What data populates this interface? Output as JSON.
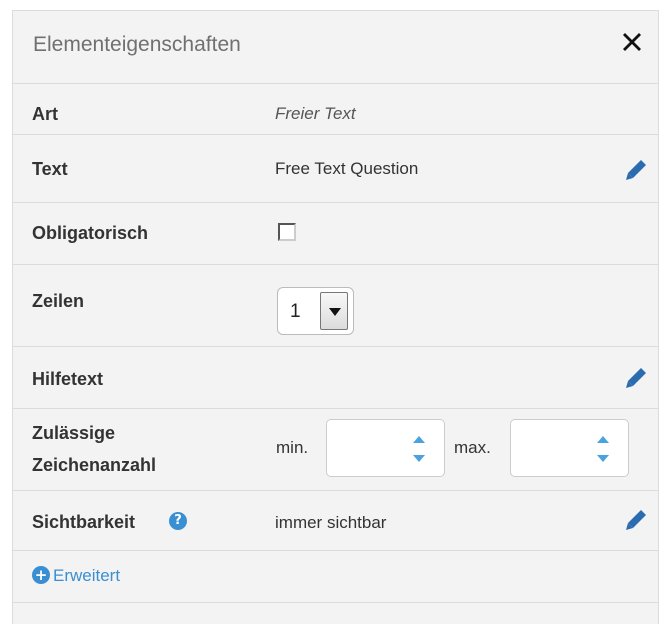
{
  "panel": {
    "title": "Elementeigenschaften"
  },
  "rows": {
    "art": {
      "label": "Art",
      "value": "Freier Text"
    },
    "text": {
      "label": "Text",
      "value": "Free Text Question"
    },
    "obligatorisch": {
      "label": "Obligatorisch",
      "checked": false
    },
    "zeilen": {
      "label": "Zeilen",
      "value": "1"
    },
    "hilfetext": {
      "label": "Hilfetext"
    },
    "zeichenanzahl": {
      "label_line1": "Zulässige",
      "label_line2": "Zeichenanzahl",
      "min_label": "min.",
      "max_label": "max.",
      "min_value": "",
      "max_value": ""
    },
    "sichtbarkeit": {
      "label": "Sichtbarkeit",
      "value": "immer sichtbar",
      "help_icon": "?"
    }
  },
  "advanced": {
    "label": "Erweitert",
    "icon": "+"
  },
  "colors": {
    "accent": "#3a8fd2",
    "panel_bg": "#f3f3f3",
    "border": "#dcdcdc"
  }
}
